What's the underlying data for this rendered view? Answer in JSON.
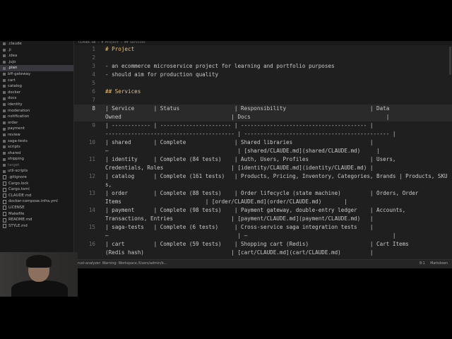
{
  "editor": {
    "tab_title": "CLAUDE.md › # Project › ## Services",
    "lines": [
      {
        "n": "1",
        "text": "# Project",
        "heading": true
      },
      {
        "n": "2",
        "text": ""
      },
      {
        "n": "3",
        "text": "- an ecommerce microservice project for learning and portfolio purposes"
      },
      {
        "n": "4",
        "text": "- should aim for production quality"
      },
      {
        "n": "5",
        "text": ""
      },
      {
        "n": "6",
        "text": "## Services",
        "heading": true
      },
      {
        "n": "7",
        "text": ""
      },
      {
        "n": "8",
        "text": "| Service      | Status                 | Responsibility                          | Data\nOwned                                  | Docs                                          |",
        "wrap": true,
        "current": true
      },
      {
        "n": "9",
        "text": "| ------------ | ---------------------- | --------------------------------------- |\n---------------------------------------- | --------------------------------------------- |",
        "wrap": true
      },
      {
        "n": "10",
        "text": "| shared       | Complete               | Shared libraries                        |\n—                                        | [shared/CLAUDE.md](shared/CLAUDE.md)     |",
        "wrap": true
      },
      {
        "n": "11",
        "text": "| identity     | Complete (84 tests)    | Auth, Users, Profiles                   | Users,\nCredentials, Roles                     | [identity/CLAUDE.md](identity/CLAUDE.md) |",
        "wrap": true
      },
      {
        "n": "12",
        "text": "| catalog      | Complete (161 tests)   | Products, Pricing, Inventory, Categories, Brands | Products, SKUs,\nImages, Stock, Categories, Brands | [catalog/CLAUDE.md](catalog/CLAUDE.md)   |",
        "wrap": true
      },
      {
        "n": "13",
        "text": "| order        | Complete (88 tests)    | Order lifecycle (state machine)         | Orders, Order\nItems                          | [order/CLAUDE.md](order/CLAUDE.md)       |",
        "wrap": true
      },
      {
        "n": "14",
        "text": "| payment      | Complete (98 tests)    | Payment gateway, double-entry ledger    | Accounts,\nTransactions, Entries                  | [payment/CLAUDE.md](payment/CLAUDE.md)   |",
        "wrap": true
      },
      {
        "n": "15",
        "text": "| saga-tests   | Complete (6 tests)     | Cross-service saga integration tests    |\n—                                        | —                                             |",
        "wrap": true
      },
      {
        "n": "16",
        "text": "| cart         | Complete (59 tests)    | Shopping cart (Redis)                   | Cart Items\n(Redis hash)                           | [cart/CLAUDE.md](cart/CLAUDE.md)         |",
        "wrap": true
      }
    ]
  },
  "sidebar": {
    "items": [
      {
        "label": ".claude",
        "type": "folder"
      },
      {
        "label": ".ji",
        "type": "folder"
      },
      {
        "label": ".idea",
        "type": "folder"
      },
      {
        "label": ".jujo",
        "type": "folder"
      },
      {
        "label": ".plan",
        "type": "folder",
        "selected": true
      },
      {
        "label": "bff-gateway",
        "type": "folder"
      },
      {
        "label": "cart",
        "type": "folder"
      },
      {
        "label": "catalog",
        "type": "folder"
      },
      {
        "label": "docker",
        "type": "folder"
      },
      {
        "label": "docs",
        "type": "folder"
      },
      {
        "label": "identity",
        "type": "folder"
      },
      {
        "label": "moderation",
        "type": "folder"
      },
      {
        "label": "notification",
        "type": "folder"
      },
      {
        "label": "order",
        "type": "folder"
      },
      {
        "label": "payment",
        "type": "folder"
      },
      {
        "label": "review",
        "type": "folder"
      },
      {
        "label": "saga-tests",
        "type": "folder"
      },
      {
        "label": "scripts",
        "type": "folder"
      },
      {
        "label": "shared",
        "type": "folder"
      },
      {
        "label": "shipping",
        "type": "folder"
      },
      {
        "label": "target",
        "type": "folder",
        "dim": true
      },
      {
        "label": "util-scripts",
        "type": "folder"
      },
      {
        "label": ".gitignore",
        "type": "file"
      },
      {
        "label": "Cargo.lock",
        "type": "file"
      },
      {
        "label": "Cargo.toml",
        "type": "file"
      },
      {
        "label": "CLAUDE.md",
        "type": "file"
      },
      {
        "label": "docker-compose.infra.yml",
        "type": "file"
      },
      {
        "label": "LICENSE",
        "type": "file"
      },
      {
        "label": "Makefile",
        "type": "file"
      },
      {
        "label": "README.md",
        "type": "file"
      },
      {
        "label": "STYLE.md",
        "type": "file"
      }
    ]
  },
  "statusbar": {
    "left": "rust-analyzer: Warning: Workspace  /Users/admin/b…",
    "position": "8:1",
    "language": "Markdown"
  }
}
